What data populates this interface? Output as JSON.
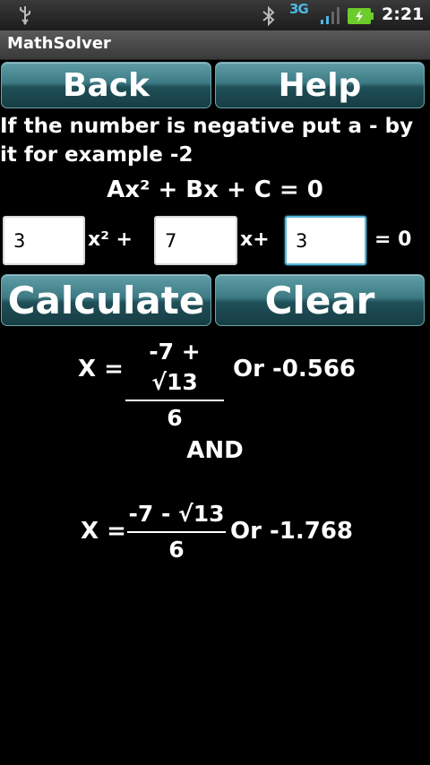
{
  "status_bar": {
    "network": "3G",
    "time": "2:21",
    "icons": [
      "usb-icon",
      "bluetooth-icon",
      "signal-icon",
      "battery-charging-icon"
    ]
  },
  "app": {
    "title": "MathSolver"
  },
  "buttons": {
    "back": "Back",
    "help": "Help",
    "calculate": "Calculate",
    "clear": "Clear"
  },
  "instructions": "If the number is negative put a - by it for example -2",
  "equation": "Ax² + Bx + C = 0",
  "inputs": {
    "a": {
      "value": "3",
      "suffix": "x² +"
    },
    "b": {
      "value": "7",
      "suffix": "x+"
    },
    "c": {
      "value": "3",
      "suffix": "= 0"
    }
  },
  "solutions": {
    "x_label": "X =",
    "root1": {
      "numerator": "-7 + √13",
      "denominator": "6",
      "decimal": "Or -0.566"
    },
    "conjunction": "AND",
    "root2": {
      "numerator": "-7 - √13",
      "denominator": "6",
      "decimal": "Or -1.768"
    }
  },
  "colors": {
    "button": "#3d7a84",
    "focus": "#56b7dc",
    "background": "#000000"
  }
}
